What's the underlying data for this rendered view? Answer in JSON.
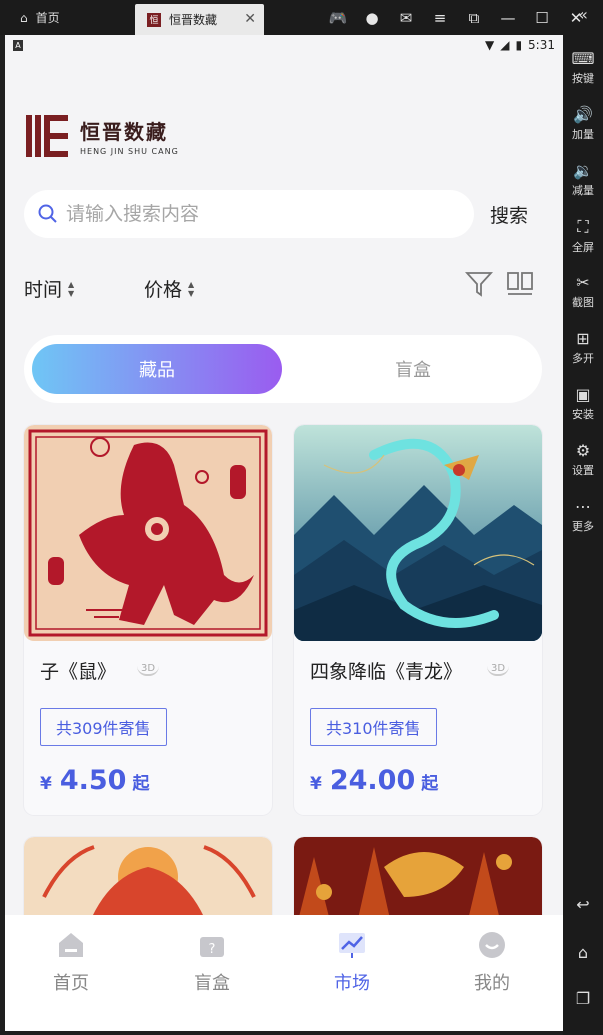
{
  "emulator": {
    "home_tab": "首页",
    "app_tab": "恒晋数藏",
    "sidebar": [
      "按键",
      "加量",
      "减量",
      "全屏",
      "截图",
      "多开",
      "安装",
      "设置",
      "更多"
    ]
  },
  "status": {
    "time": "5:31",
    "left_icon": "A"
  },
  "brand": {
    "name_cn": "恒晋数藏",
    "name_en": "HENG JIN SHU CANG",
    "mark": "恒"
  },
  "search": {
    "placeholder": "请输入搜索内容",
    "button": "搜索"
  },
  "sort": {
    "time": "时间",
    "price": "价格"
  },
  "tabs": {
    "active": "藏品",
    "inactive": "盲盒"
  },
  "cards": [
    {
      "name": "子《鼠》",
      "badge": "3D",
      "tag": "共309件寄售",
      "currency": "¥",
      "price": "4.50",
      "suffix": "起"
    },
    {
      "name": "四象降临《青龙》",
      "badge": "3D",
      "tag": "共310件寄售",
      "currency": "¥",
      "price": "24.00",
      "suffix": "起"
    }
  ],
  "nav": [
    {
      "label": "首页",
      "icon": "home-icon"
    },
    {
      "label": "盲盒",
      "icon": "blind-box-icon"
    },
    {
      "label": "市场",
      "icon": "market-chart-icon",
      "active": true
    },
    {
      "label": "我的",
      "icon": "profile-smile-icon"
    }
  ],
  "colors": {
    "accent": "#5064e6",
    "tab_gradient_start": "#6fc6f5",
    "tab_gradient_end": "#9a5cf0",
    "brand": "#7a1f22"
  }
}
